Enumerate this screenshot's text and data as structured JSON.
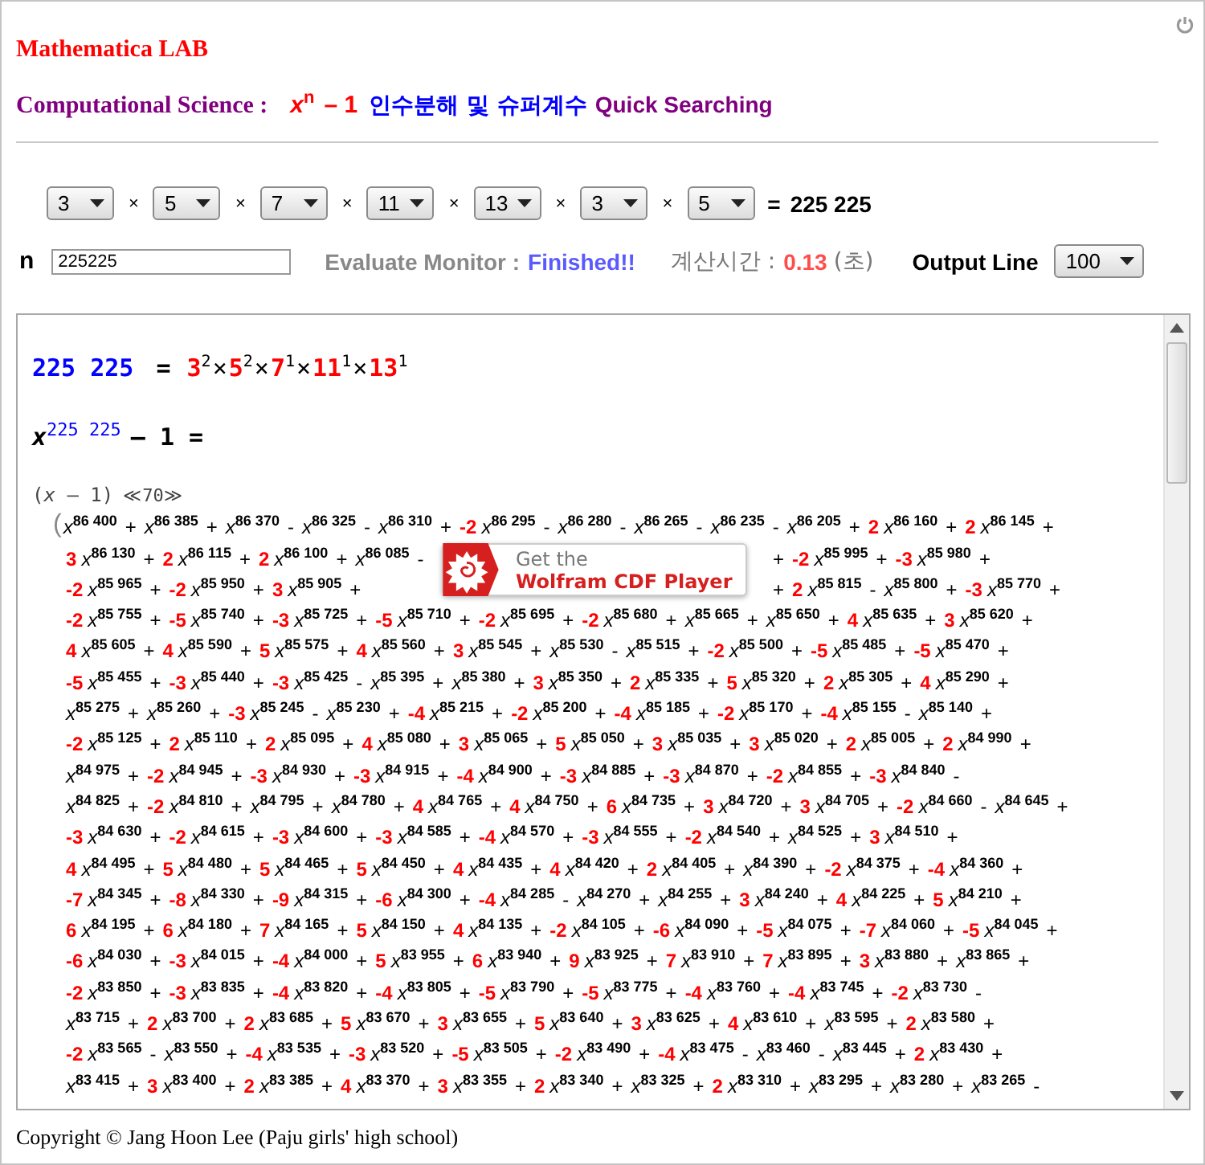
{
  "header": {
    "title": "Mathematica LAB",
    "subtitle": {
      "label": "Computational Science :",
      "formula": "*x*$^{n}$",
      "minus_one": "– 1",
      "korean": "인수분해 및 슈퍼계수",
      "suffix": "Quick Searching"
    }
  },
  "factor_selects": [
    {
      "value": "3"
    },
    {
      "sep": "×",
      "value": "5"
    },
    {
      "sep": "×",
      "value": "7"
    },
    {
      "sep": "×",
      "value": "11"
    },
    {
      "sep": "×",
      "value": "13"
    },
    {
      "sep": "×",
      "value": "3"
    },
    {
      "sep": "×",
      "value": "5"
    }
  ],
  "product": {
    "equals": "=",
    "value": "225 225"
  },
  "controls": {
    "n_label": "n",
    "n_value": "225225",
    "monitor_label": "Evaluate Monitor :",
    "monitor_status": "Finished!!",
    "time_label": "계산시간 :",
    "time_value": "0.13",
    "time_unit": "(초)",
    "output_label": "Output Line",
    "output_value": "100"
  },
  "output": {
    "factorization": {
      "n": "225 225",
      "equals": "=",
      "factors": [
        {
          "base": "3",
          "exp": "2"
        },
        {
          "sep": "×",
          "base": "5",
          "exp": "2"
        },
        {
          "sep": "×",
          "base": "7",
          "exp": "1"
        },
        {
          "sep": "×",
          "base": "11",
          "exp": "1"
        },
        {
          "sep": "×",
          "base": "13",
          "exp": "1"
        }
      ]
    },
    "equation": {
      "power": "*x*$^{225 225}$",
      "rest": "– 1 ="
    },
    "factor_line": {
      "factor": "(*x* – 1)",
      "omitted": "≪70≫"
    },
    "polynomial": {
      "bracket": "(",
      "lines": [
        {
          "terms": [
            {
              "power": "*x*$^{86 400}$"
            },
            {
              "op": "+",
              "power": "*x*$^{86 385}$"
            },
            {
              "op": "+",
              "power": "*x*$^{86 370}$"
            },
            {
              "op": "-",
              "power": "*x*$^{86 325}$"
            },
            {
              "op": "-",
              "power": "*x*$^{86 310}$"
            },
            {
              "op": "+",
              "coef": "-2",
              "power": "*x*$^{86 295}$"
            },
            {
              "op": "-",
              "power": "*x*$^{86 280}$"
            },
            {
              "op": "-",
              "power": "*x*$^{86 265}$"
            },
            {
              "op": "-",
              "power": "*x*$^{86 235}$"
            },
            {
              "op": "-",
              "power": "*x*$^{86 205}$"
            },
            {
              "op": "+",
              "coef": "2",
              "power": "*x*$^{86 160}$"
            },
            {
              "op": "+",
              "coef": "2",
              "power": "*x*$^{86 145}$"
            }
          ],
          "end_op": "+"
        },
        {
          "terms": [
            {
              "coef": "3",
              "power": "*x*$^{86 130}$"
            },
            {
              "op": "+",
              "coef": "2",
              "power": "*x*$^{86 115}$"
            },
            {
              "op": "+",
              "coef": "2",
              "power": "*x*$^{86 100}$"
            },
            {
              "op": "+",
              "power": "*x*$^{86 085}$"
            }
          ],
          "end_op": "-",
          "after_overlay": {
            "terms": [
              {
                "op": "+",
                "coef": "-2",
                "power": "*x*$^{85 995}$"
              },
              {
                "op": "+",
                "coef": "-3",
                "power": "*x*$^{85 980}$"
              }
            ],
            "end_op": "+"
          }
        },
        {
          "terms": [
            {
              "coef": "-2",
              "power": "*x*$^{85 965}$"
            },
            {
              "op": "+",
              "coef": "-2",
              "power": "*x*$^{85 950}$"
            },
            {
              "op": "+",
              "coef": "3",
              "power": "*x*$^{85 905}$"
            }
          ],
          "end_op": "+",
          "after_overlay": {
            "terms": [
              {
                "op": "+",
                "coef": "2",
                "power": "*x*$^{85 815}$"
              },
              {
                "op": "-",
                "power": "*x*$^{85 800}$"
              },
              {
                "op": "+",
                "coef": "-3",
                "power": "*x*$^{85 770}$"
              }
            ],
            "end_op": "+"
          }
        },
        {
          "terms": [
            {
              "coef": "-2",
              "power": "*x*$^{85 755}$"
            },
            {
              "op": "+",
              "coef": "-5",
              "power": "*x*$^{85 740}$"
            },
            {
              "op": "+",
              "coef": "-3",
              "power": "*x*$^{85 725}$"
            },
            {
              "op": "+",
              "coef": "-5",
              "power": "*x*$^{85 710}$"
            },
            {
              "op": "+",
              "coef": "-2",
              "power": "*x*$^{85 695}$"
            },
            {
              "op": "+",
              "coef": "-2",
              "power": "*x*$^{85 680}$"
            },
            {
              "op": "+",
              "power": "*x*$^{85 665}$"
            },
            {
              "op": "+",
              "power": "*x*$^{85 650}$"
            },
            {
              "op": "+",
              "coef": "4",
              "power": "*x*$^{85 635}$"
            },
            {
              "op": "+",
              "coef": "3",
              "power": "*x*$^{85 620}$"
            }
          ],
          "end_op": "+"
        },
        {
          "terms": [
            {
              "coef": "4",
              "power": "*x*$^{85 605}$"
            },
            {
              "op": "+",
              "coef": "4",
              "power": "*x*$^{85 590}$"
            },
            {
              "op": "+",
              "coef": "5",
              "power": "*x*$^{85 575}$"
            },
            {
              "op": "+",
              "coef": "4",
              "power": "*x*$^{85 560}$"
            },
            {
              "op": "+",
              "coef": "3",
              "power": "*x*$^{85 545}$"
            },
            {
              "op": "+",
              "power": "*x*$^{85 530}$"
            },
            {
              "op": "-",
              "power": "*x*$^{85 515}$"
            },
            {
              "op": "+",
              "coef": "-2",
              "power": "*x*$^{85 500}$"
            },
            {
              "op": "+",
              "coef": "-5",
              "power": "*x*$^{85 485}$"
            },
            {
              "op": "+",
              "coef": "-5",
              "power": "*x*$^{85 470}$"
            }
          ],
          "end_op": "+"
        },
        {
          "terms": [
            {
              "coef": "-5",
              "power": "*x*$^{85 455}$"
            },
            {
              "op": "+",
              "coef": "-3",
              "power": "*x*$^{85 440}$"
            },
            {
              "op": "+",
              "coef": "-3",
              "power": "*x*$^{85 425}$"
            },
            {
              "op": "-",
              "power": "*x*$^{85 395}$"
            },
            {
              "op": "+",
              "power": "*x*$^{85 380}$"
            },
            {
              "op": "+",
              "coef": "3",
              "power": "*x*$^{85 350}$"
            },
            {
              "op": "+",
              "coef": "2",
              "power": "*x*$^{85 335}$"
            },
            {
              "op": "+",
              "coef": "5",
              "power": "*x*$^{85 320}$"
            },
            {
              "op": "+",
              "coef": "2",
              "power": "*x*$^{85 305}$"
            },
            {
              "op": "+",
              "coef": "4",
              "power": "*x*$^{85 290}$"
            }
          ],
          "end_op": "+"
        },
        {
          "terms": [
            {
              "power": "*x*$^{85 275}$"
            },
            {
              "op": "+",
              "power": "*x*$^{85 260}$"
            },
            {
              "op": "+",
              "coef": "-3",
              "power": "*x*$^{85 245}$"
            },
            {
              "op": "-",
              "power": "*x*$^{85 230}$"
            },
            {
              "op": "+",
              "coef": "-4",
              "power": "*x*$^{85 215}$"
            },
            {
              "op": "+",
              "coef": "-2",
              "power": "*x*$^{85 200}$"
            },
            {
              "op": "+",
              "coef": "-4",
              "power": "*x*$^{85 185}$"
            },
            {
              "op": "+",
              "coef": "-2",
              "power": "*x*$^{85 170}$"
            },
            {
              "op": "+",
              "coef": "-4",
              "power": "*x*$^{85 155}$"
            },
            {
              "op": "-",
              "power": "*x*$^{85 140}$"
            }
          ],
          "end_op": "+"
        },
        {
          "terms": [
            {
              "coef": "-2",
              "power": "*x*$^{85 125}$"
            },
            {
              "op": "+",
              "coef": "2",
              "power": "*x*$^{85 110}$"
            },
            {
              "op": "+",
              "coef": "2",
              "power": "*x*$^{85 095}$"
            },
            {
              "op": "+",
              "coef": "4",
              "power": "*x*$^{85 080}$"
            },
            {
              "op": "+",
              "coef": "3",
              "power": "*x*$^{85 065}$"
            },
            {
              "op": "+",
              "coef": "5",
              "power": "*x*$^{85 050}$"
            },
            {
              "op": "+",
              "coef": "3",
              "power": "*x*$^{85 035}$"
            },
            {
              "op": "+",
              "coef": "3",
              "power": "*x*$^{85 020}$"
            },
            {
              "op": "+",
              "coef": "2",
              "power": "*x*$^{85 005}$"
            },
            {
              "op": "+",
              "coef": "2",
              "power": "*x*$^{84 990}$"
            }
          ],
          "end_op": "+"
        },
        {
          "terms": [
            {
              "power": "*x*$^{84 975}$"
            },
            {
              "op": "+",
              "coef": "-2",
              "power": "*x*$^{84 945}$"
            },
            {
              "op": "+",
              "coef": "-3",
              "power": "*x*$^{84 930}$"
            },
            {
              "op": "+",
              "coef": "-3",
              "power": "*x*$^{84 915}$"
            },
            {
              "op": "+",
              "coef": "-4",
              "power": "*x*$^{84 900}$"
            },
            {
              "op": "+",
              "coef": "-3",
              "power": "*x*$^{84 885}$"
            },
            {
              "op": "+",
              "coef": "-3",
              "power": "*x*$^{84 870}$"
            },
            {
              "op": "+",
              "coef": "-2",
              "power": "*x*$^{84 855}$"
            },
            {
              "op": "+",
              "coef": "-3",
              "power": "*x*$^{84 840}$"
            }
          ],
          "end_op": "-"
        },
        {
          "terms": [
            {
              "power": "*x*$^{84 825}$"
            },
            {
              "op": "+",
              "coef": "-2",
              "power": "*x*$^{84 810}$"
            },
            {
              "op": "+",
              "power": "*x*$^{84 795}$"
            },
            {
              "op": "+",
              "power": "*x*$^{84 780}$"
            },
            {
              "op": "+",
              "coef": "4",
              "power": "*x*$^{84 765}$"
            },
            {
              "op": "+",
              "coef": "4",
              "power": "*x*$^{84 750}$"
            },
            {
              "op": "+",
              "coef": "6",
              "power": "*x*$^{84 735}$"
            },
            {
              "op": "+",
              "coef": "3",
              "power": "*x*$^{84 720}$"
            },
            {
              "op": "+",
              "coef": "3",
              "power": "*x*$^{84 705}$"
            },
            {
              "op": "+",
              "coef": "-2",
              "power": "*x*$^{84 660}$"
            },
            {
              "op": "-",
              "power": "*x*$^{84 645}$"
            }
          ],
          "end_op": "+"
        },
        {
          "terms": [
            {
              "coef": "-3",
              "power": "*x*$^{84 630}$"
            },
            {
              "op": "+",
              "coef": "-2",
              "power": "*x*$^{84 615}$"
            },
            {
              "op": "+",
              "coef": "-3",
              "power": "*x*$^{84 600}$"
            },
            {
              "op": "+",
              "coef": "-3",
              "power": "*x*$^{84 585}$"
            },
            {
              "op": "+",
              "coef": "-4",
              "power": "*x*$^{84 570}$"
            },
            {
              "op": "+",
              "coef": "-3",
              "power": "*x*$^{84 555}$"
            },
            {
              "op": "+",
              "coef": "-2",
              "power": "*x*$^{84 540}$"
            },
            {
              "op": "+",
              "power": "*x*$^{84 525}$"
            },
            {
              "op": "+",
              "coef": "3",
              "power": "*x*$^{84 510}$"
            }
          ],
          "end_op": "+"
        },
        {
          "terms": [
            {
              "coef": "4",
              "power": "*x*$^{84 495}$"
            },
            {
              "op": "+",
              "coef": "5",
              "power": "*x*$^{84 480}$"
            },
            {
              "op": "+",
              "coef": "5",
              "power": "*x*$^{84 465}$"
            },
            {
              "op": "+",
              "coef": "5",
              "power": "*x*$^{84 450}$"
            },
            {
              "op": "+",
              "coef": "4",
              "power": "*x*$^{84 435}$"
            },
            {
              "op": "+",
              "coef": "4",
              "power": "*x*$^{84 420}$"
            },
            {
              "op": "+",
              "coef": "2",
              "power": "*x*$^{84 405}$"
            },
            {
              "op": "+",
              "power": "*x*$^{84 390}$"
            },
            {
              "op": "+",
              "coef": "-2",
              "power": "*x*$^{84 375}$"
            },
            {
              "op": "+",
              "coef": "-4",
              "power": "*x*$^{84 360}$"
            }
          ],
          "end_op": "+"
        },
        {
          "terms": [
            {
              "coef": "-7",
              "power": "*x*$^{84 345}$"
            },
            {
              "op": "+",
              "coef": "-8",
              "power": "*x*$^{84 330}$"
            },
            {
              "op": "+",
              "coef": "-9",
              "power": "*x*$^{84 315}$"
            },
            {
              "op": "+",
              "coef": "-6",
              "power": "*x*$^{84 300}$"
            },
            {
              "op": "+",
              "coef": "-4",
              "power": "*x*$^{84 285}$"
            },
            {
              "op": "-",
              "power": "*x*$^{84 270}$"
            },
            {
              "op": "+",
              "power": "*x*$^{84 255}$"
            },
            {
              "op": "+",
              "coef": "3",
              "power": "*x*$^{84 240}$"
            },
            {
              "op": "+",
              "coef": "4",
              "power": "*x*$^{84 225}$"
            },
            {
              "op": "+",
              "coef": "5",
              "power": "*x*$^{84 210}$"
            }
          ],
          "end_op": "+"
        },
        {
          "terms": [
            {
              "coef": "6",
              "power": "*x*$^{84 195}$"
            },
            {
              "op": "+",
              "coef": "6",
              "power": "*x*$^{84 180}$"
            },
            {
              "op": "+",
              "coef": "7",
              "power": "*x*$^{84 165}$"
            },
            {
              "op": "+",
              "coef": "5",
              "power": "*x*$^{84 150}$"
            },
            {
              "op": "+",
              "coef": "4",
              "power": "*x*$^{84 135}$"
            },
            {
              "op": "+",
              "coef": "-2",
              "power": "*x*$^{84 105}$"
            },
            {
              "op": "+",
              "coef": "-6",
              "power": "*x*$^{84 090}$"
            },
            {
              "op": "+",
              "coef": "-5",
              "power": "*x*$^{84 075}$"
            },
            {
              "op": "+",
              "coef": "-7",
              "power": "*x*$^{84 060}$"
            },
            {
              "op": "+",
              "coef": "-5",
              "power": "*x*$^{84 045}$"
            }
          ],
          "end_op": "+"
        },
        {
          "terms": [
            {
              "coef": "-6",
              "power": "*x*$^{84 030}$"
            },
            {
              "op": "+",
              "coef": "-3",
              "power": "*x*$^{84 015}$"
            },
            {
              "op": "+",
              "coef": "-4",
              "power": "*x*$^{84 000}$"
            },
            {
              "op": "+",
              "coef": "5",
              "power": "*x*$^{83 955}$"
            },
            {
              "op": "+",
              "coef": "6",
              "power": "*x*$^{83 940}$"
            },
            {
              "op": "+",
              "coef": "9",
              "power": "*x*$^{83 925}$"
            },
            {
              "op": "+",
              "coef": "7",
              "power": "*x*$^{83 910}$"
            },
            {
              "op": "+",
              "coef": "7",
              "power": "*x*$^{83 895}$"
            },
            {
              "op": "+",
              "coef": "3",
              "power": "*x*$^{83 880}$"
            },
            {
              "op": "+",
              "power": "*x*$^{83 865}$"
            }
          ],
          "end_op": "+"
        },
        {
          "terms": [
            {
              "coef": "-2",
              "power": "*x*$^{83 850}$"
            },
            {
              "op": "+",
              "coef": "-3",
              "power": "*x*$^{83 835}$"
            },
            {
              "op": "+",
              "coef": "-4",
              "power": "*x*$^{83 820}$"
            },
            {
              "op": "+",
              "coef": "-4",
              "power": "*x*$^{83 805}$"
            },
            {
              "op": "+",
              "coef": "-5",
              "power": "*x*$^{83 790}$"
            },
            {
              "op": "+",
              "coef": "-5",
              "power": "*x*$^{83 775}$"
            },
            {
              "op": "+",
              "coef": "-4",
              "power": "*x*$^{83 760}$"
            },
            {
              "op": "+",
              "coef": "-4",
              "power": "*x*$^{83 745}$"
            },
            {
              "op": "+",
              "coef": "-2",
              "power": "*x*$^{83 730}$"
            }
          ],
          "end_op": "-"
        },
        {
          "terms": [
            {
              "power": "*x*$^{83 715}$"
            },
            {
              "op": "+",
              "coef": "2",
              "power": "*x*$^{83 700}$"
            },
            {
              "op": "+",
              "coef": "2",
              "power": "*x*$^{83 685}$"
            },
            {
              "op": "+",
              "coef": "5",
              "power": "*x*$^{83 670}$"
            },
            {
              "op": "+",
              "coef": "3",
              "power": "*x*$^{83 655}$"
            },
            {
              "op": "+",
              "coef": "5",
              "power": "*x*$^{83 640}$"
            },
            {
              "op": "+",
              "coef": "3",
              "power": "*x*$^{83 625}$"
            },
            {
              "op": "+",
              "coef": "4",
              "power": "*x*$^{83 610}$"
            },
            {
              "op": "+",
              "power": "*x*$^{83 595}$"
            },
            {
              "op": "+",
              "coef": "2",
              "power": "*x*$^{83 580}$"
            }
          ],
          "end_op": "+"
        },
        {
          "terms": [
            {
              "coef": "-2",
              "power": "*x*$^{83 565}$"
            },
            {
              "op": "-",
              "power": "*x*$^{83 550}$"
            },
            {
              "op": "+",
              "coef": "-4",
              "power": "*x*$^{83 535}$"
            },
            {
              "op": "+",
              "coef": "-3",
              "power": "*x*$^{83 520}$"
            },
            {
              "op": "+",
              "coef": "-5",
              "power": "*x*$^{83 505}$"
            },
            {
              "op": "+",
              "coef": "-2",
              "power": "*x*$^{83 490}$"
            },
            {
              "op": "+",
              "coef": "-4",
              "power": "*x*$^{83 475}$"
            },
            {
              "op": "-",
              "power": "*x*$^{83 460}$"
            },
            {
              "op": "-",
              "power": "*x*$^{83 445}$"
            },
            {
              "op": "+",
              "coef": "2",
              "power": "*x*$^{83 430}$"
            }
          ],
          "end_op": "+"
        },
        {
          "terms": [
            {
              "power": "*x*$^{83 415}$"
            },
            {
              "op": "+",
              "coef": "3",
              "power": "*x*$^{83 400}$"
            },
            {
              "op": "+",
              "coef": "2",
              "power": "*x*$^{83 385}$"
            },
            {
              "op": "+",
              "coef": "4",
              "power": "*x*$^{83 370}$"
            },
            {
              "op": "+",
              "coef": "3",
              "power": "*x*$^{83 355}$"
            },
            {
              "op": "+",
              "coef": "2",
              "power": "*x*$^{83 340}$"
            },
            {
              "op": "+",
              "power": "*x*$^{83 325}$"
            },
            {
              "op": "+",
              "coef": "2",
              "power": "*x*$^{83 310}$"
            },
            {
              "op": "+",
              "power": "*x*$^{83 295}$"
            },
            {
              "op": "+",
              "power": "*x*$^{83 280}$"
            },
            {
              "op": "+",
              "power": "*x*$^{83 265}$"
            }
          ],
          "end_op": "-"
        }
      ]
    },
    "player_badge": {
      "caption": "Get the",
      "title": "Wolfram CDF Player"
    }
  },
  "footer": "Copyright © Jang Hoon Lee (Paju girls' high school)"
}
